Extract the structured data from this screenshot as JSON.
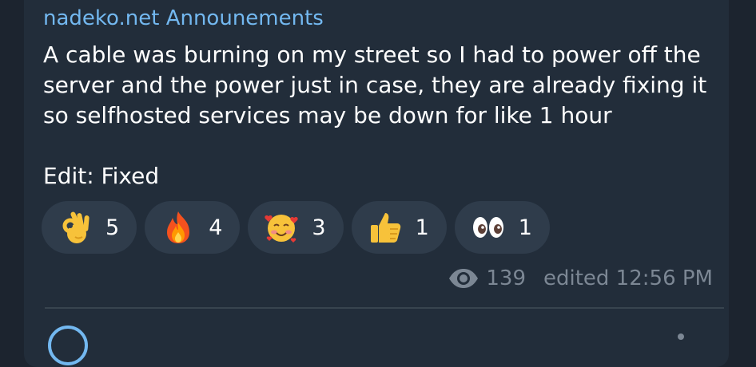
{
  "message": {
    "channel_name": "nadeko.net Announements",
    "text": "A cable was burning on my street so I had to power off the\nserver and the power just in case, they are already fixing it\nso selfhosted services may be down for like 1 hour\n\nEdit: Fixed",
    "views": "139",
    "edited_label": "edited 12:56 PM"
  },
  "reactions": [
    {
      "icon": "ok-hand-icon",
      "count": "5"
    },
    {
      "icon": "fire-icon",
      "count": "4"
    },
    {
      "icon": "smiling-face-with-hearts-icon",
      "count": "3"
    },
    {
      "icon": "thumbs-up-icon",
      "count": "1"
    },
    {
      "icon": "eyes-icon",
      "count": "1"
    }
  ],
  "colors": {
    "background": "#1c242f",
    "bubble": "#222d3a",
    "channel_name": "#73b8f0",
    "reaction_pill": "#2f3c4b",
    "meta_text": "#7c8794"
  }
}
